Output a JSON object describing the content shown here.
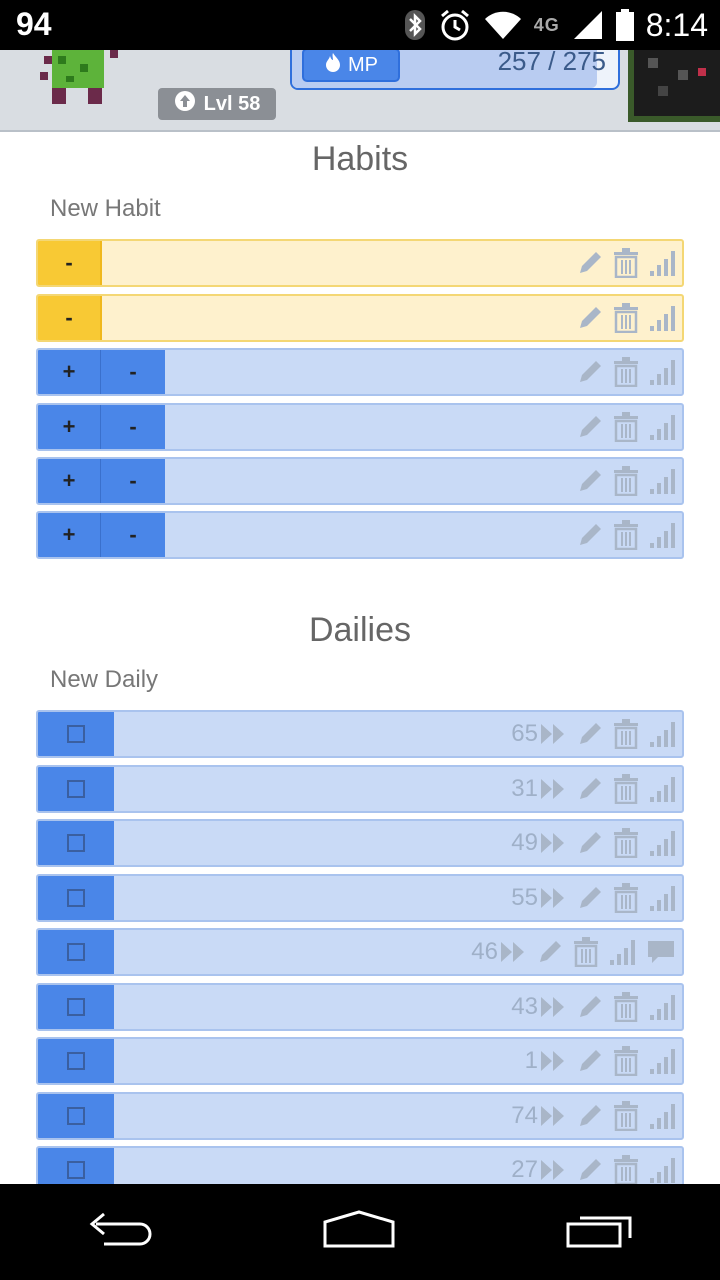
{
  "status_bar": {
    "battery_text": "94",
    "time": "8:14",
    "network": "4G"
  },
  "header": {
    "level": "Lvl 58",
    "mp_label": "MP",
    "mp_value": "257 / 275",
    "mp_current": 257,
    "mp_max": 275
  },
  "habits": {
    "title": "Habits",
    "new_placeholder": "New Habit",
    "items": [
      {
        "type": "neg",
        "minus_label": "-"
      },
      {
        "type": "neg",
        "minus_label": "-"
      },
      {
        "type": "both",
        "plus_label": "+",
        "minus_label": "-"
      },
      {
        "type": "both",
        "plus_label": "+",
        "minus_label": "-"
      },
      {
        "type": "both",
        "plus_label": "+",
        "minus_label": "-"
      },
      {
        "type": "both",
        "plus_label": "+",
        "minus_label": "-"
      }
    ]
  },
  "dailies": {
    "title": "Dailies",
    "new_placeholder": "New Daily",
    "items": [
      {
        "streak": "65"
      },
      {
        "streak": "31"
      },
      {
        "streak": "49"
      },
      {
        "streak": "55"
      },
      {
        "streak": "46",
        "has_comment": true
      },
      {
        "streak": "43"
      },
      {
        "streak": "1"
      },
      {
        "streak": "74"
      },
      {
        "streak": "27"
      }
    ]
  },
  "colors": {
    "habit_neg_bg": "#fef1cd",
    "habit_neg_btn": "#f8c934",
    "blue_bg": "#c9daf6",
    "blue_btn": "#4a86e8"
  }
}
